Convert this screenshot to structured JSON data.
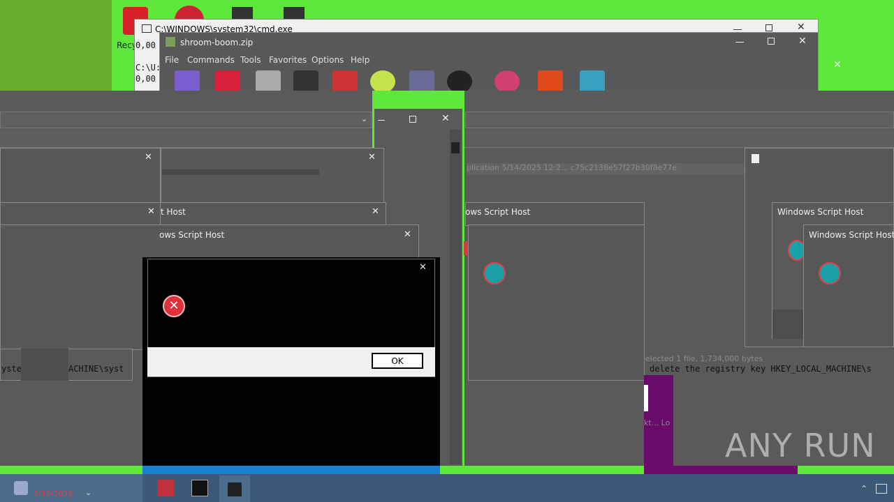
{
  "desktop": {
    "recycle_label": "Recy",
    "icon_colors": [
      "#e33",
      "#e33",
      "#ddd",
      "#ddd"
    ]
  },
  "cmd_window": {
    "title": "C:\\WINDOWS\\system32\\cmd.exe",
    "line1": "0,00",
    "line2": "C:\\U:",
    "line3": "0,00"
  },
  "winrar": {
    "title": "shroom-boom.zip",
    "menu": [
      "File",
      "Commands",
      "Tools",
      "Favorites",
      "Options",
      "Help"
    ],
    "file_row_text": "plication   5/14/2025 12:2...   c75c2138e57f27b30f8e77e",
    "status_text": "elected 1 file, 1,734,000 bytes"
  },
  "wsh": {
    "title_partial_1": "t Host",
    "title_partial_2": "ows Script Host",
    "title_partial_3": "ows Script Host",
    "title_full": "Windows Script Host"
  },
  "error_dialog": {
    "ok_label": "OK"
  },
  "console_text": {
    "left": "yste",
    "left2": "ACHINE\\syst",
    "right": "delete the registry key HKEY_LOCAL_MACHINE\\s"
  },
  "small_text": {
    "lower_right": "kt...  Lo"
  },
  "watermark": {
    "text": "ANY RUN"
  },
  "taskbar": {
    "clock": "5/15/2025"
  },
  "colors": {
    "green": "#5ee83a",
    "purple": "#6a0a6a",
    "blue": "#1b7fd4"
  }
}
